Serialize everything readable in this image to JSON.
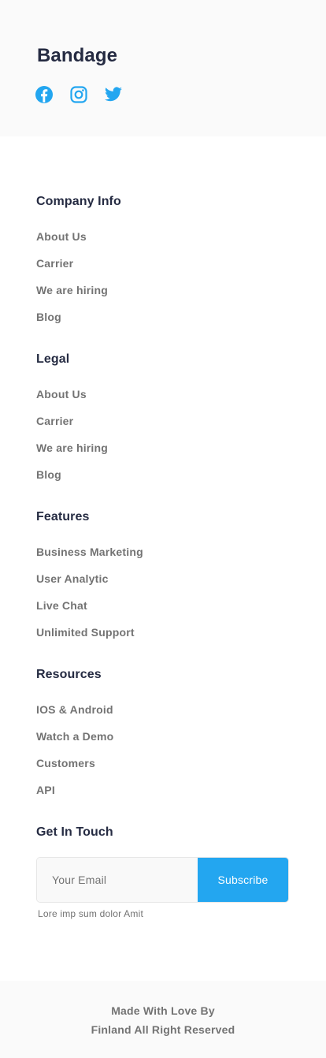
{
  "brand": {
    "name": "Bandage",
    "social": [
      {
        "icon": "facebook-icon",
        "label": "Facebook"
      },
      {
        "icon": "instagram-icon",
        "label": "Instagram"
      },
      {
        "icon": "twitter-icon",
        "label": "Twitter"
      }
    ]
  },
  "colors": {
    "heading": "#252B42",
    "text_muted": "#737373",
    "accent": "#23A6F0",
    "band_background": "#FAFAFA"
  },
  "columns": [
    {
      "title": "Company Info",
      "links": [
        "About Us",
        "Carrier",
        "We are hiring",
        "Blog"
      ]
    },
    {
      "title": "Legal",
      "links": [
        "About Us",
        "Carrier",
        "We are hiring",
        "Blog"
      ]
    },
    {
      "title": "Features",
      "links": [
        "Business Marketing",
        "User Analytic",
        "Live Chat",
        "Unlimited Support"
      ]
    },
    {
      "title": "Resources",
      "links": [
        "IOS & Android",
        "Watch a Demo",
        "Customers",
        "API"
      ]
    }
  ],
  "contact": {
    "title": "Get In Touch",
    "email_placeholder": "Your Email",
    "email_value": "",
    "subscribe_label": "Subscribe",
    "note": "Lore imp sum dolor Amit"
  },
  "footer": {
    "line1": "Made With Love By",
    "line2": "Finland All Right Reserved"
  }
}
